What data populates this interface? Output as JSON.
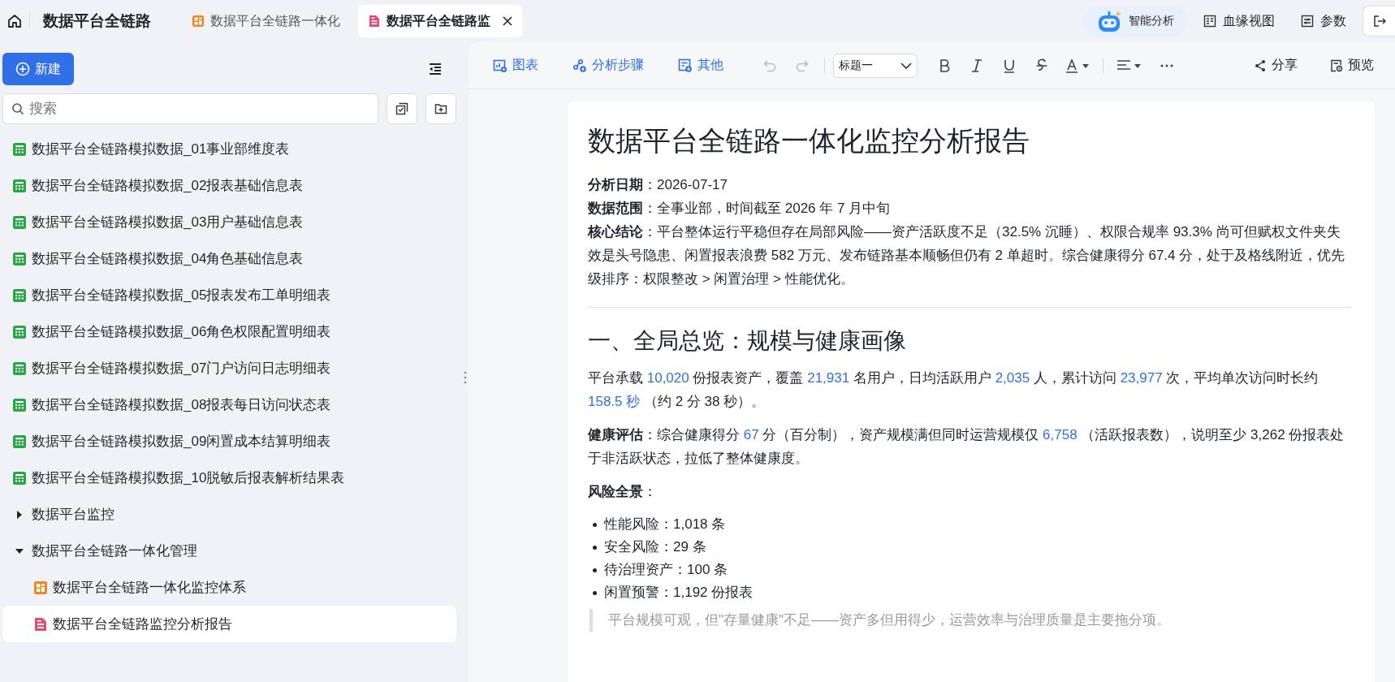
{
  "topbar": {
    "title": "数据平台全链路",
    "tabs": [
      {
        "label": "数据平台全链路一体化",
        "kind": "dashboard",
        "selected": false
      },
      {
        "label": "数据平台全链路监",
        "kind": "report",
        "selected": true
      }
    ],
    "actions": [
      {
        "label": "智能分析",
        "kind": "ai"
      },
      {
        "label": "血缘视图",
        "kind": "lineage"
      },
      {
        "label": "参数",
        "kind": "params"
      }
    ]
  },
  "sidebar": {
    "new_button": "新建",
    "search": {
      "placeholder": "搜索"
    },
    "tree": [
      {
        "label": "数据平台全链路模拟数据_01事业部维度表",
        "kind": "table",
        "selected": false
      },
      {
        "label": "数据平台全链路模拟数据_02报表基础信息表",
        "kind": "table",
        "selected": false
      },
      {
        "label": "数据平台全链路模拟数据_03用户基础信息表",
        "kind": "table",
        "selected": false
      },
      {
        "label": "数据平台全链路模拟数据_04角色基础信息表",
        "kind": "table",
        "selected": false
      },
      {
        "label": "数据平台全链路模拟数据_05报表发布工单明细表",
        "kind": "table",
        "selected": false
      },
      {
        "label": "数据平台全链路模拟数据_06角色权限配置明细表",
        "kind": "table",
        "selected": false
      },
      {
        "label": "数据平台全链路模拟数据_07门户访问日志明细表",
        "kind": "table",
        "selected": false
      },
      {
        "label": "数据平台全链路模拟数据_08报表每日访问状态表",
        "kind": "table",
        "selected": false
      },
      {
        "label": "数据平台全链路模拟数据_09闲置成本结算明细表",
        "kind": "table",
        "selected": false
      },
      {
        "label": "数据平台全链路模拟数据_10脱敏后报表解析结果表",
        "kind": "table",
        "selected": false
      },
      {
        "label": "数据平台监控",
        "kind": "folder",
        "expanded": false,
        "selected": false
      },
      {
        "label": "数据平台全链路一体化管理",
        "kind": "folder",
        "expanded": true,
        "selected": false,
        "children": [
          {
            "label": "数据平台全链路一体化监控体系",
            "kind": "dashboard",
            "selected": false
          },
          {
            "label": "数据平台全链路监控分析报告",
            "kind": "report",
            "selected": true
          }
        ]
      }
    ]
  },
  "toolbar": {
    "inserts": [
      {
        "label": "图表",
        "kind": "chart"
      },
      {
        "label": "分析步骤",
        "kind": "steps"
      },
      {
        "label": "其他",
        "kind": "other"
      }
    ],
    "history": [
      {
        "kind": "undo",
        "disabled": true
      },
      {
        "kind": "redo",
        "disabled": true
      }
    ],
    "heading_select": "标题一",
    "share": "分享",
    "preview": "预览"
  },
  "document": {
    "title": "数据平台全链路一体化监控分析报告",
    "meta": [
      "**分析日期**：2026-07-17",
      "**数据范围**：全事业部，时间截至 2026 年 7 月中旬",
      "**核心结论**：平台整体运行平稳但存在局部风险——资产活跃度不足（32.5% 沉睡）、权限合规率 93.3% 尚可但赋权文件夹失效是头号隐患、闲置报表浪费 582 万元、发布链路基本顺畅但仍有 2 单超时。综合健康得分 67.4 分，处于及格线附近，优先级排序：权限整改 > 闲置治理 > 性能优化。"
    ],
    "sections": [
      {
        "heading": "一、全局总览：规模与健康画像",
        "blocks": [
          {
            "kind": "paragraph",
            "segments": [
              {
                "kind": "text",
                "text": "平台承载 "
              },
              {
                "kind": "number",
                "text": "10,020"
              },
              {
                "kind": "text",
                "text": " 份报表资产，覆盖 "
              },
              {
                "kind": "number",
                "text": "21,931"
              },
              {
                "kind": "text",
                "text": " 名用户，日均活跃用户 "
              },
              {
                "kind": "number",
                "text": "2,035"
              },
              {
                "kind": "text",
                "text": " 人，累计访问 "
              },
              {
                "kind": "number",
                "text": "23,977"
              },
              {
                "kind": "text",
                "text": " 次，平均单次访问时长约 "
              },
              {
                "kind": "number",
                "text": "158.5 秒"
              },
              {
                "kind": "text",
                "text": " （约 2 分 38 秒）。"
              }
            ]
          },
          {
            "kind": "paragraph",
            "segments": [
              {
                "kind": "bold",
                "text": "健康评估"
              },
              {
                "kind": "text",
                "text": "：综合健康得分 "
              },
              {
                "kind": "number",
                "text": "67"
              },
              {
                "kind": "text",
                "text": " 分（百分制），资产规模满但同时运营规模仅 "
              },
              {
                "kind": "number",
                "text": "6,758"
              },
              {
                "kind": "text",
                "text": " （活跃报表数），说明至少 3,262 份报表处于非活跃状态，拉低了整体健康度。"
              }
            ]
          },
          {
            "kind": "paragraph",
            "segments": [
              {
                "kind": "bold",
                "text": "风险全景"
              },
              {
                "kind": "text",
                "text": "："
              }
            ]
          },
          {
            "kind": "list",
            "items": [
              "性能风险：1,018 条",
              "安全风险：29 条",
              "待治理资产：100 条",
              "闲置预警：1,192 份报表"
            ]
          },
          {
            "kind": "quote",
            "text": "平台规模可观，但\"存量健康\"不足——资产多但用得少，运营效率与治理质量是主要拖分项。"
          }
        ]
      }
    ]
  }
}
